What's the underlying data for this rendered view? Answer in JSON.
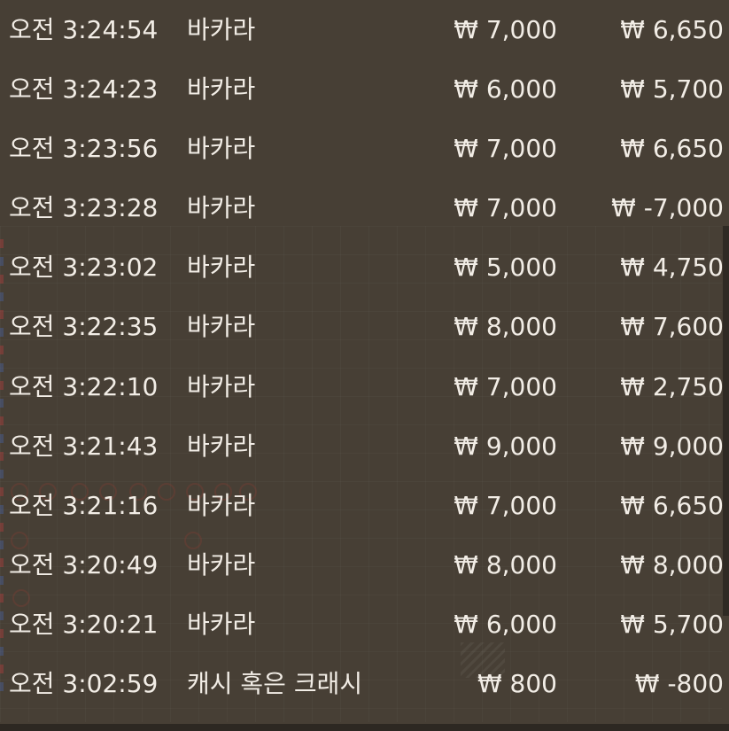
{
  "history": {
    "rows": [
      {
        "time": "오전 3:24:54",
        "game": "바카라",
        "bet": "₩ 7,000",
        "result": "₩ 6,650"
      },
      {
        "time": "오전 3:24:23",
        "game": "바카라",
        "bet": "₩ 6,000",
        "result": "₩ 5,700"
      },
      {
        "time": "오전 3:23:56",
        "game": "바카라",
        "bet": "₩ 7,000",
        "result": "₩ 6,650"
      },
      {
        "time": "오전 3:23:28",
        "game": "바카라",
        "bet": "₩ 7,000",
        "result": "₩ -7,000"
      },
      {
        "time": "오전 3:23:02",
        "game": "바카라",
        "bet": "₩ 5,000",
        "result": "₩ 4,750"
      },
      {
        "time": "오전 3:22:35",
        "game": "바카라",
        "bet": "₩ 8,000",
        "result": "₩ 7,600"
      },
      {
        "time": "오전 3:22:10",
        "game": "바카라",
        "bet": "₩ 7,000",
        "result": "₩ 2,750"
      },
      {
        "time": "오전 3:21:43",
        "game": "바카라",
        "bet": "₩ 9,000",
        "result": "₩ 9,000"
      },
      {
        "time": "오전 3:21:16",
        "game": "바카라",
        "bet": "₩ 7,000",
        "result": "₩ 6,650"
      },
      {
        "time": "오전 3:20:49",
        "game": "바카라",
        "bet": "₩ 8,000",
        "result": "₩ 8,000"
      },
      {
        "time": "오전 3:20:21",
        "game": "바카라",
        "bet": "₩ 6,000",
        "result": "₩ 5,700"
      },
      {
        "time": "오전 3:02:59",
        "game": "캐시 혹은 크래시",
        "bet": "₩ 800",
        "result": "₩ -800"
      }
    ]
  },
  "colors": {
    "background": "#473f35",
    "text": "#f2ede6"
  }
}
